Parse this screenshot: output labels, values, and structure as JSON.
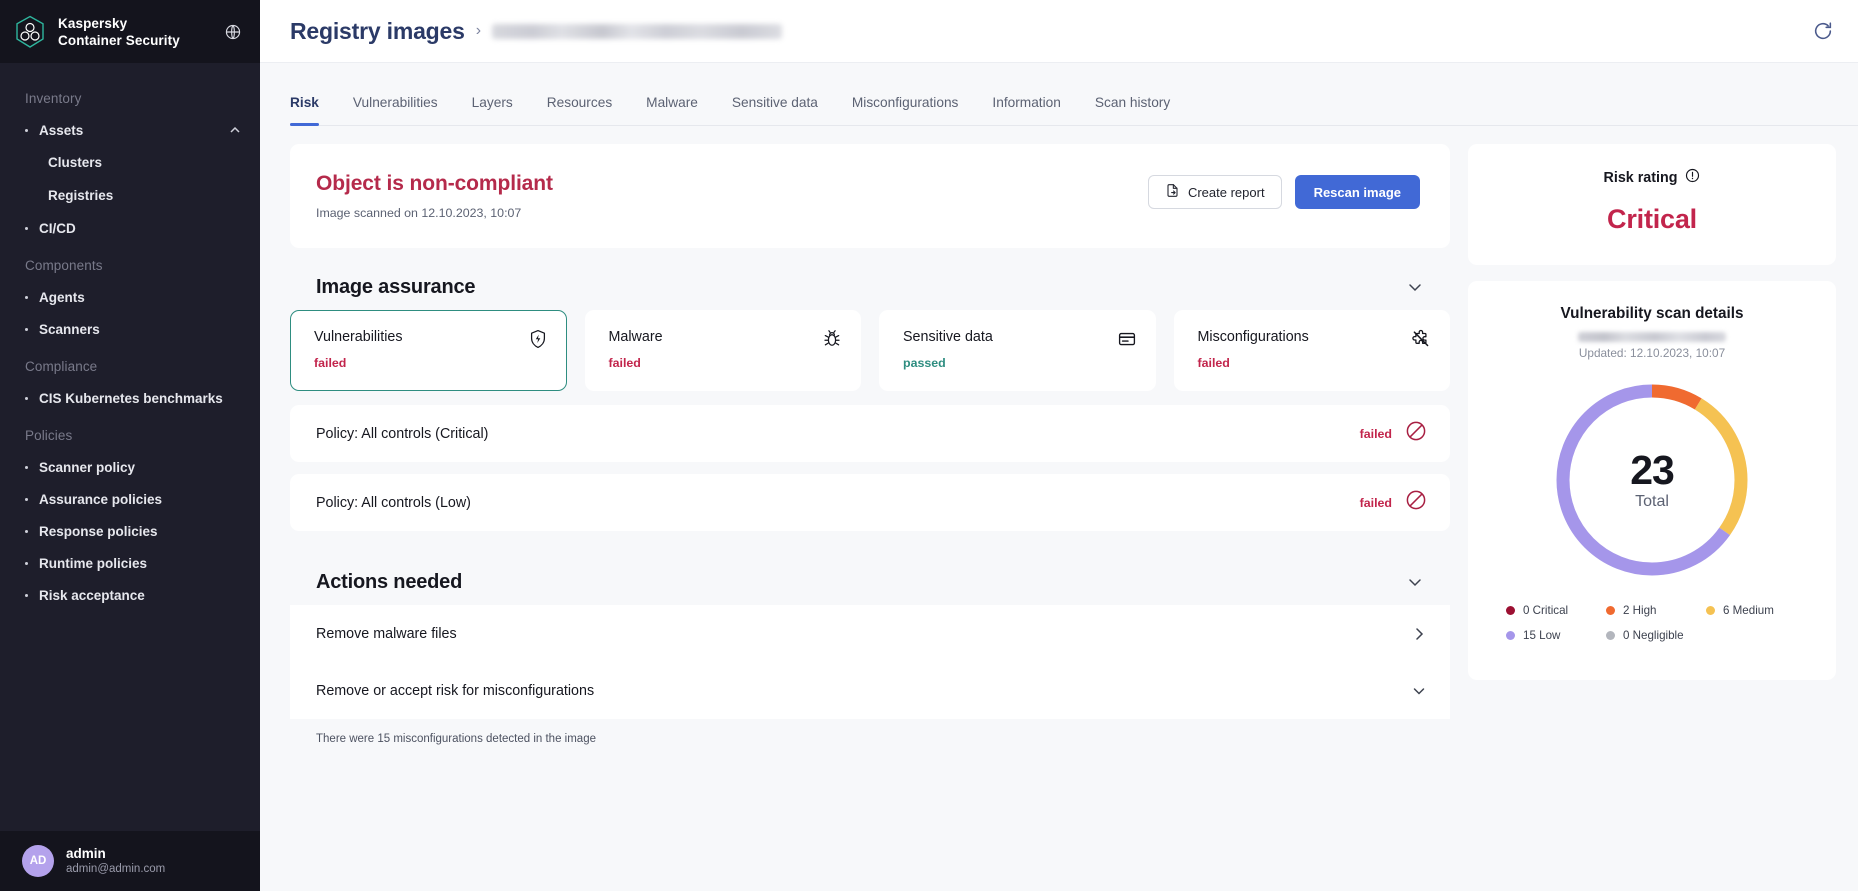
{
  "brand": {
    "line1": "Kaspersky",
    "line2": "Container Security",
    "logo_icon": "cube-hexagon-icon",
    "globe_icon": "globe-icon"
  },
  "sidebar": {
    "groups": [
      {
        "title": "Inventory",
        "items": [
          {
            "label": "Assets",
            "icon": "chevron-up-icon",
            "expanded": true,
            "children": [
              {
                "label": "Clusters"
              },
              {
                "label": "Registries"
              }
            ]
          },
          {
            "label": "CI/CD"
          }
        ]
      },
      {
        "title": "Components",
        "items": [
          {
            "label": "Agents"
          },
          {
            "label": "Scanners"
          }
        ]
      },
      {
        "title": "Compliance",
        "items": [
          {
            "label": "CIS Kubernetes benchmarks"
          }
        ]
      },
      {
        "title": "Policies",
        "items": [
          {
            "label": "Scanner policy"
          },
          {
            "label": "Assurance policies"
          },
          {
            "label": "Response policies"
          },
          {
            "label": "Runtime policies"
          },
          {
            "label": "Risk acceptance"
          }
        ]
      }
    ],
    "user": {
      "initials": "AD",
      "name": "admin",
      "email": "admin@admin.com"
    }
  },
  "topbar": {
    "breadcrumb_root": "Registry images",
    "breadcrumb_separator": "›",
    "breadcrumb_current": "",
    "refresh_icon": "refresh-icon"
  },
  "tabs": [
    {
      "label": "Risk",
      "active": true
    },
    {
      "label": "Vulnerabilities",
      "active": false
    },
    {
      "label": "Layers",
      "active": false
    },
    {
      "label": "Resources",
      "active": false
    },
    {
      "label": "Malware",
      "active": false
    },
    {
      "label": "Sensitive data",
      "active": false
    },
    {
      "label": "Misconfigurations",
      "active": false
    },
    {
      "label": "Information",
      "active": false
    },
    {
      "label": "Scan history",
      "active": false
    }
  ],
  "status": {
    "title": "Object is non-compliant",
    "subtitle": "Image scanned on 12.10.2023, 10:07",
    "create_report_label": "Create report",
    "create_report_icon": "document-export-icon",
    "rescan_label": "Rescan image"
  },
  "image_assurance": {
    "title": "Image assurance",
    "collapse_icon": "chevron-down-icon",
    "cards": [
      {
        "name": "Vulnerabilities",
        "state": "failed",
        "icon": "shield-bolt-icon",
        "selected": true
      },
      {
        "name": "Malware",
        "state": "failed",
        "icon": "bug-icon",
        "selected": false
      },
      {
        "name": "Sensitive data",
        "state": "passed",
        "icon": "card-data-icon",
        "selected": false
      },
      {
        "name": "Misconfigurations",
        "state": "failed",
        "icon": "puzzle-slash-icon",
        "selected": false
      }
    ],
    "policies": [
      {
        "name": "Policy: All controls (Critical)",
        "state": "failed",
        "icon": "blocked-icon"
      },
      {
        "name": "Policy: All controls (Low)",
        "state": "failed",
        "icon": "blocked-icon"
      }
    ]
  },
  "actions_needed": {
    "title": "Actions needed",
    "collapse_icon": "chevron-down-icon",
    "items": [
      {
        "label": "Remove malware files",
        "icon": "chevron-right-icon"
      },
      {
        "label": "Remove or accept risk for misconfigurations",
        "icon": "chevron-down-icon"
      }
    ],
    "note": "There were 15 misconfigurations detected in the image"
  },
  "risk_rating": {
    "label": "Risk rating",
    "info_icon": "info-circle-icon",
    "value": "Critical",
    "value_color": "#c2254c"
  },
  "scan_details": {
    "title": "Vulnerability scan details",
    "scanner_name": "",
    "updated": "Updated: 12.10.2023, 10:07"
  },
  "chart_data": {
    "type": "pie",
    "title": "Vulnerability scan details",
    "total_label": "Total",
    "total": 23,
    "categories": [
      "Critical",
      "High",
      "Medium",
      "Low",
      "Negligible"
    ],
    "values": [
      0,
      2,
      6,
      15,
      0
    ],
    "colors": [
      "#9c1032",
      "#f06a30",
      "#f5c252",
      "#a596ea",
      "#b3b6bd"
    ],
    "legend": [
      {
        "label": "0 Critical",
        "value": 0,
        "color": "#9c1032"
      },
      {
        "label": "2 High",
        "value": 2,
        "color": "#f06a30"
      },
      {
        "label": "6 Medium",
        "value": 6,
        "color": "#f5c252"
      },
      {
        "label": "15 Low",
        "value": 15,
        "color": "#a596ea"
      },
      {
        "label": "0 Negligible",
        "value": 0,
        "color": "#b3b6bd"
      }
    ],
    "legend_position": "bottom",
    "donut": true
  }
}
